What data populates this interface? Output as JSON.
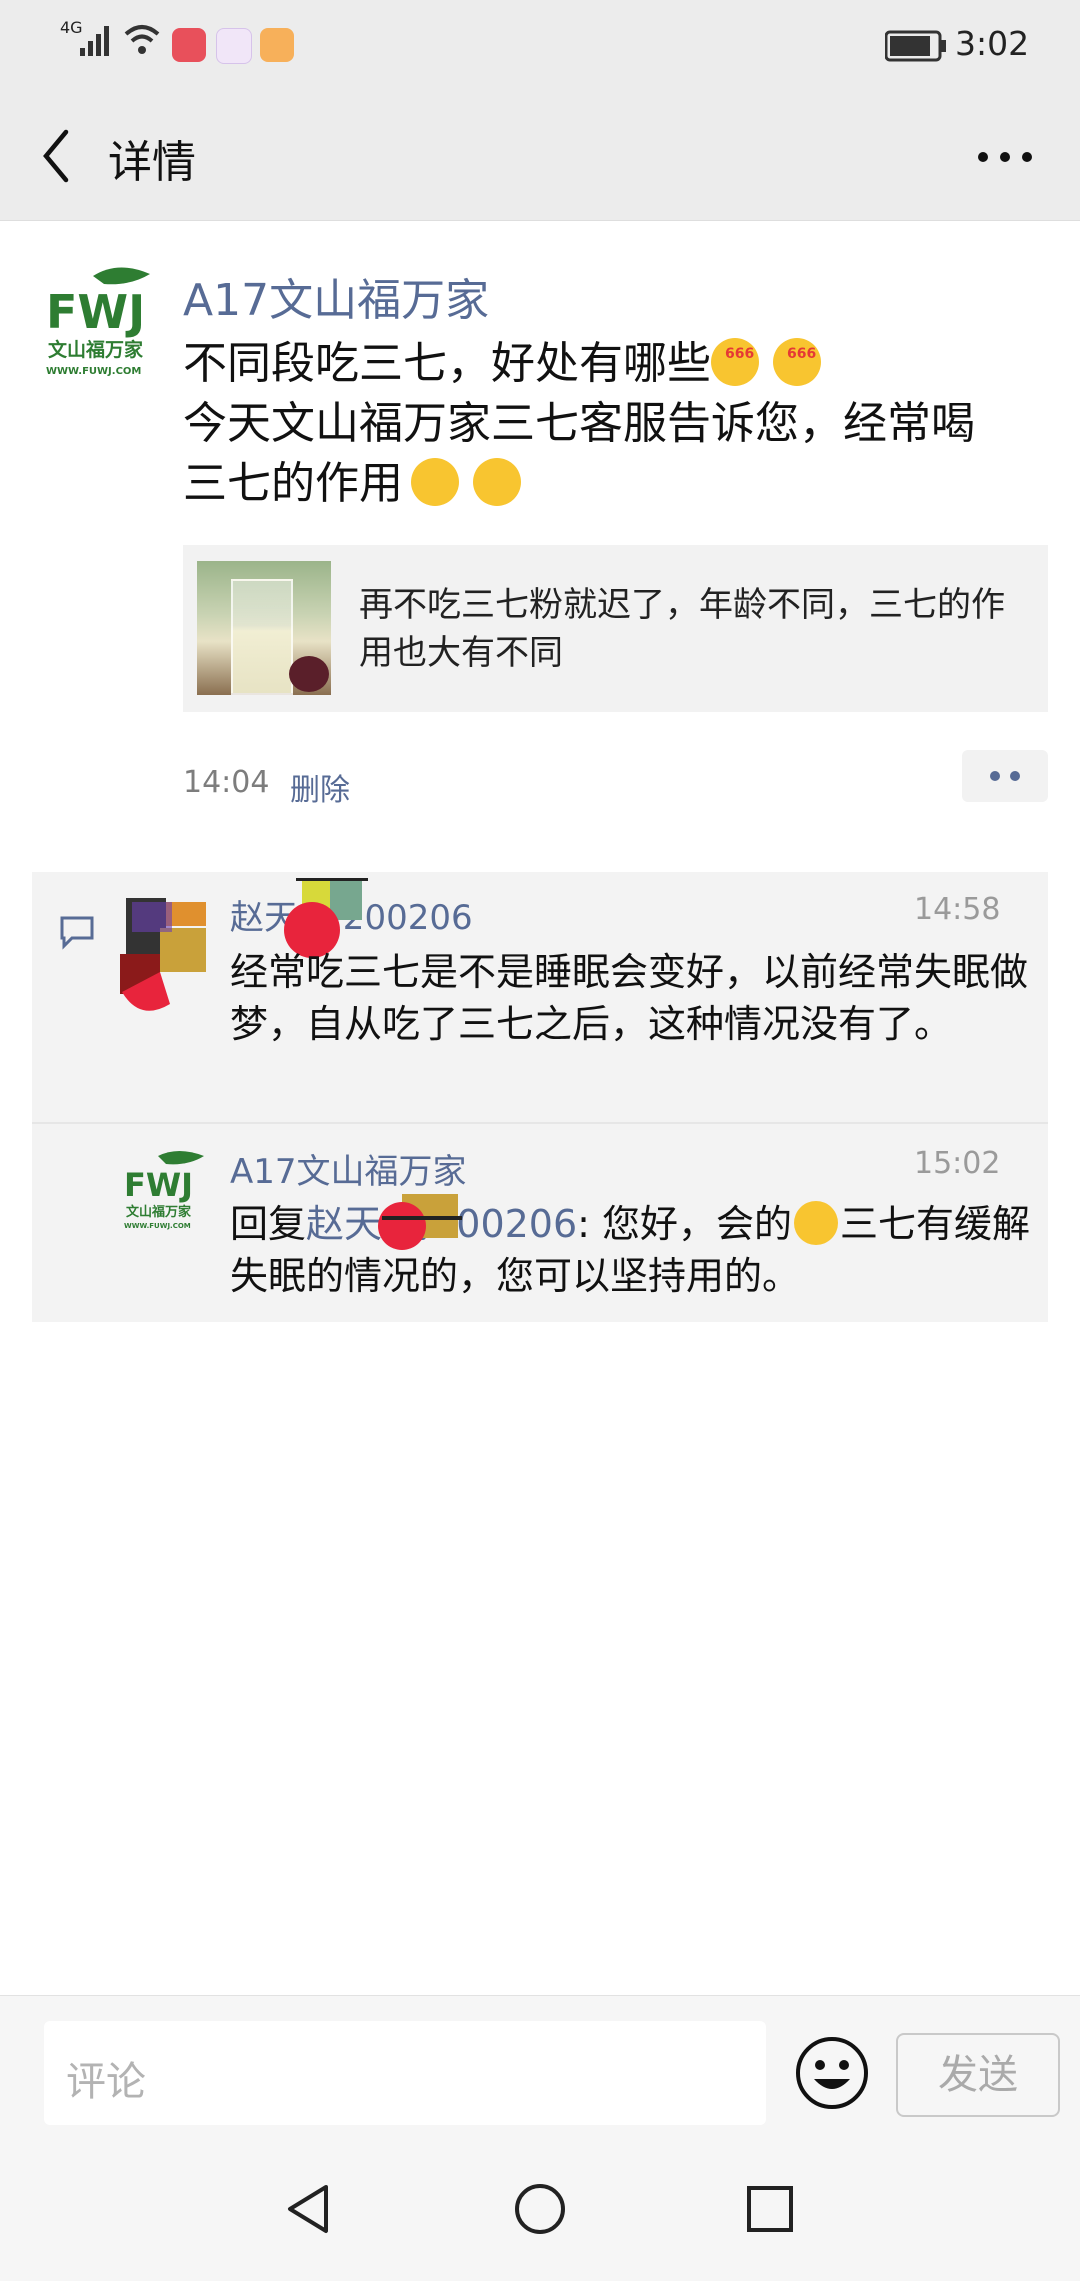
{
  "status": {
    "network": "4G",
    "time": "3:02"
  },
  "header": {
    "title": "详情"
  },
  "post": {
    "author": "A17文山福万家",
    "line1": "不同段吃三七，好处有哪些",
    "line2": "今天文山福万家三七客服告诉您，经常喝",
    "line3": "三七的作用",
    "card_title": "再不吃三七粉就迟了，年龄不同，三七的作用也大有不同",
    "time": "14:04",
    "delete_label": "删除",
    "logo": {
      "brand": "FWJ",
      "name": "文山福万家",
      "site": "WWW.FUWJ.COM"
    },
    "emoji_666_label": "666"
  },
  "comments": [
    {
      "name": "赵天 粉200206",
      "time": "14:58",
      "text": "经常吃三七是不是睡眠会变好，以前经常失眠做梦，自从吃了三七之后，这种情况没有了。"
    },
    {
      "name": "A17文山福万家",
      "time": "15:02",
      "reply_prefix": "回复",
      "reply_to": "赵天 粉200206",
      "reply_sep": ": 您好，会的",
      "text_after": "三七有缓解失眠的情况的，您可以坚持用的。"
    }
  ],
  "bottom": {
    "placeholder": "评论",
    "send_label": "发送"
  },
  "colors": {
    "link": "#576b95",
    "logo_green": "#2e7d32"
  }
}
